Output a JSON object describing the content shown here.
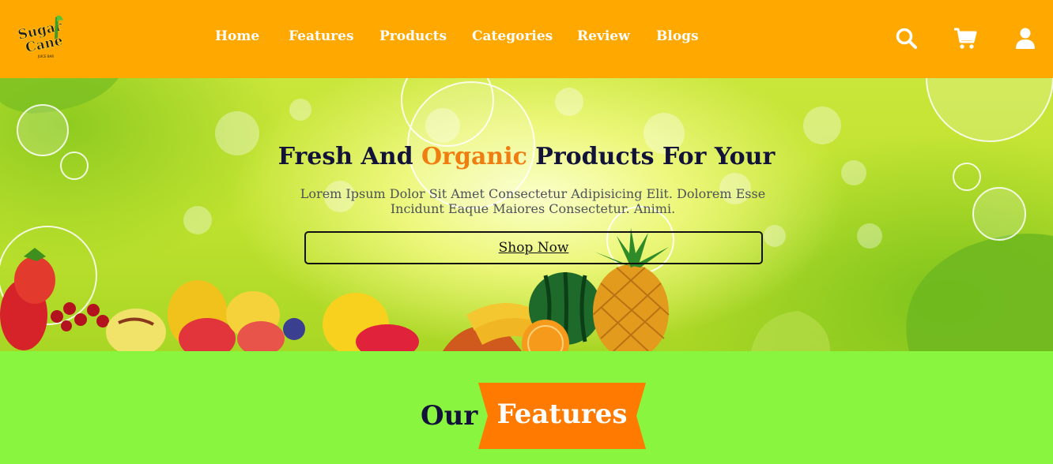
{
  "brand": {
    "logo_line1": "Sugar",
    "logo_line2": "Cane",
    "logo_tagline": "JUICE BAR"
  },
  "nav": {
    "items": [
      {
        "label": "Home"
      },
      {
        "label": "Features"
      },
      {
        "label": "Products"
      },
      {
        "label": "Categories"
      },
      {
        "label": "Review"
      },
      {
        "label": "Blogs"
      }
    ]
  },
  "header_icons": [
    "search-icon",
    "cart-icon",
    "user-icon"
  ],
  "hero": {
    "title_pre": "Fresh And ",
    "title_highlight": "Organic",
    "title_post": " Products For Your",
    "description": "Lorem Ipsum Dolor Sit Amet Consectetur Adipisicing Elit. Dolorem Esse Incidunt Eaque Maiores Consectetur. Animi.",
    "cta_label": "Shop Now"
  },
  "features_section": {
    "title_word1": "Our",
    "title_word2": "Features"
  },
  "colors": {
    "header_bg": "#ffa800",
    "accent_orange": "#f07d10",
    "ribbon_orange": "#ff7a00",
    "section_green": "#8af53e",
    "dark_text": "#13133a"
  }
}
